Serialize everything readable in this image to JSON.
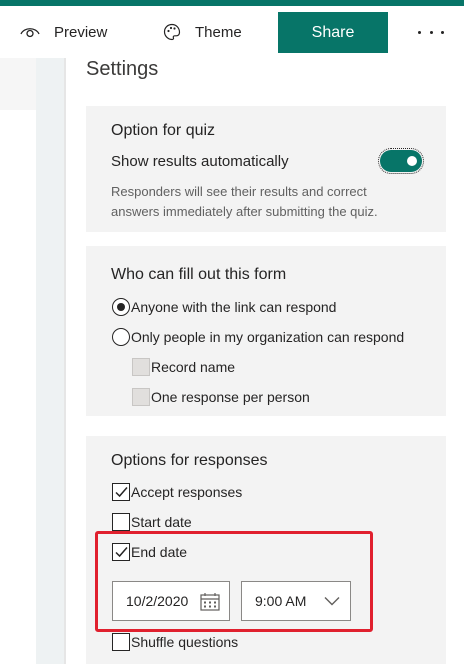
{
  "toolbar": {
    "preview_label": "Preview",
    "theme_label": "Theme",
    "share_label": "Share",
    "more_label": "More options",
    "preview_icon": "eye-icon",
    "theme_icon": "palette-icon",
    "more_icon": "ellipsis-icon"
  },
  "settings": {
    "title": "Settings",
    "quiz": {
      "heading": "Option for quiz",
      "toggle_label": "Show results automatically",
      "toggle_on": true,
      "description_line1": "Responders will see their results and correct",
      "description_line2": "answers immediately after submitting the quiz."
    },
    "who": {
      "heading": "Who can fill out this form",
      "option_anyone": "Anyone with the link can respond",
      "option_org": "Only people in my organization can respond",
      "selected": "option_anyone",
      "record_name": "Record name",
      "one_response": "One response per person"
    },
    "responses": {
      "heading": "Options for responses",
      "accept_responses": "Accept responses",
      "accept_checked": true,
      "start_date": "Start date",
      "start_checked": false,
      "end_date": "End date",
      "end_checked": true,
      "end_date_value": "10/2/2020",
      "end_time_value": "9:00 AM",
      "shuffle_questions": "Shuffle questions",
      "shuffle_checked": false
    }
  },
  "colors": {
    "accent": "#077568",
    "highlight": "#e0202e",
    "card_bg": "#f3f3f3"
  }
}
